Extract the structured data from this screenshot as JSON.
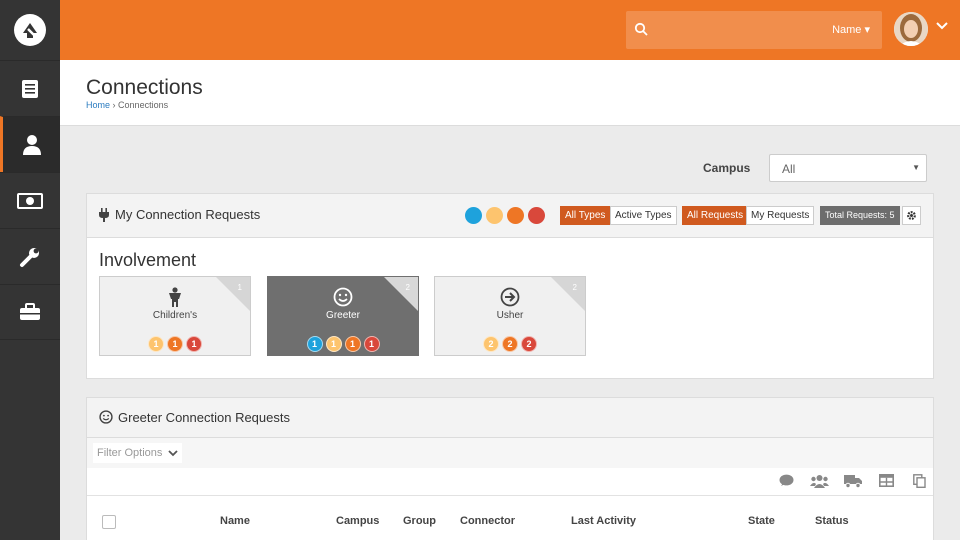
{
  "header": {
    "search_filter": "Name ▾"
  },
  "page": {
    "title": "Connections",
    "breadcrumb": {
      "home": "Home",
      "separator": "›",
      "current": "Connections"
    }
  },
  "campus": {
    "label": "Campus",
    "selected": "All"
  },
  "requests_panel": {
    "title": "My Connection Requests",
    "status_colors": [
      "#1ea2dc",
      "#fdc46e",
      "#ee7625",
      "#d9483b"
    ],
    "type_filters": [
      {
        "label": "All Types",
        "active": true
      },
      {
        "label": "Active Types",
        "active": false
      }
    ],
    "request_filters": [
      {
        "label": "All Requests",
        "active": true
      },
      {
        "label": "My Requests",
        "active": false
      }
    ],
    "total": "Total Requests: 5",
    "section_heading": "Involvement",
    "tiles": [
      {
        "name": "Children's",
        "count": "1",
        "icon": "child-icon",
        "pills": [
          {
            "v": "1",
            "c": "#fdc46e"
          },
          {
            "v": "1",
            "c": "#ee7625"
          },
          {
            "v": "1",
            "c": "#d9483b"
          }
        ]
      },
      {
        "name": "Greeter",
        "count": "2",
        "icon": "smile-icon",
        "selected": true,
        "pills": [
          {
            "v": "1",
            "c": "#1ea2dc"
          },
          {
            "v": "1",
            "c": "#fdc46e"
          },
          {
            "v": "1",
            "c": "#ee7625"
          },
          {
            "v": "1",
            "c": "#d9483b"
          }
        ]
      },
      {
        "name": "Usher",
        "count": "2",
        "icon": "arrow-circle-icon",
        "pills": [
          {
            "v": "2",
            "c": "#fdc46e"
          },
          {
            "v": "2",
            "c": "#ee7625"
          },
          {
            "v": "2",
            "c": "#d9483b"
          }
        ]
      }
    ]
  },
  "greeter_panel": {
    "title": "Greeter Connection Requests",
    "filter_label": "Filter Options",
    "columns": [
      "Name",
      "Campus",
      "Group",
      "Connector",
      "Last Activity",
      "State",
      "Status"
    ]
  }
}
